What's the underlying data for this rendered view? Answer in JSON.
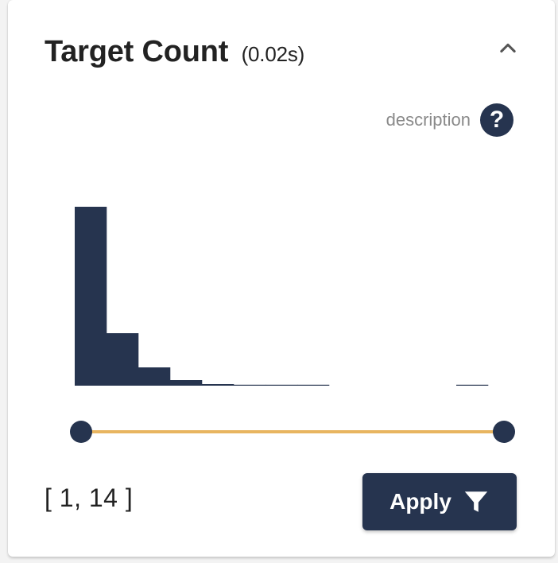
{
  "card": {
    "title": "Target Count",
    "time": "(0.02s)",
    "description_label": "description",
    "help_glyph": "?",
    "collapse_icon": "chevron-up-icon",
    "help_icon": "help-icon",
    "range_label": "[ 1, 14 ]",
    "apply_label": "Apply",
    "apply_icon": "funnel-icon",
    "colors": {
      "accent": "#26344f",
      "slider_track": "#e8b560",
      "muted_text": "#8a8a8a"
    }
  },
  "chart_data": {
    "type": "bar",
    "title": "",
    "xlabel": "",
    "ylabel": "",
    "bins": 13,
    "values": [
      225,
      66,
      23,
      7,
      2,
      1,
      1,
      1,
      0,
      0,
      0,
      0,
      1
    ],
    "ylim": [
      0,
      225
    ],
    "grid": false
  },
  "slider": {
    "min": 1,
    "max": 14,
    "low": 1,
    "high": 14
  }
}
